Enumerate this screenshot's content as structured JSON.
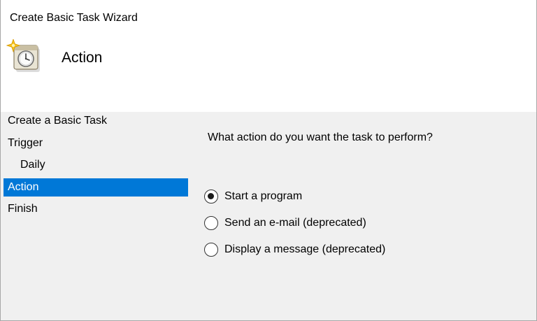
{
  "window": {
    "title": "Create Basic Task Wizard"
  },
  "header": {
    "title": "Action",
    "icon": "scheduled-task-clock-icon"
  },
  "steps": [
    {
      "label": "Create a Basic Task",
      "indent": false,
      "active": false
    },
    {
      "label": "Trigger",
      "indent": false,
      "active": false
    },
    {
      "label": "Daily",
      "indent": true,
      "active": false
    },
    {
      "label": "Action",
      "indent": false,
      "active": true
    },
    {
      "label": "Finish",
      "indent": false,
      "active": false
    }
  ],
  "main": {
    "prompt": "What action do you want the task to perform?",
    "options": [
      {
        "label": "Start a program",
        "selected": true
      },
      {
        "label": "Send an e-mail (deprecated)",
        "selected": false
      },
      {
        "label": "Display a message (deprecated)",
        "selected": false
      }
    ]
  },
  "colors": {
    "selection": "#0078d7",
    "panel_background": "#f0f0f0",
    "header_background": "#ffffff"
  }
}
